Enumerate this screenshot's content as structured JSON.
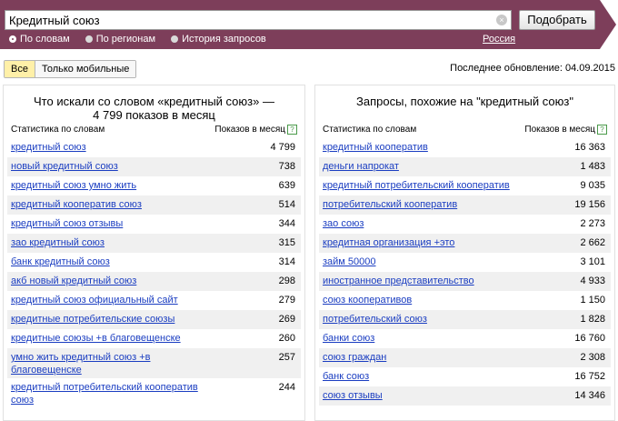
{
  "search": {
    "query": "Кредитный союз",
    "submit_label": "Подобрать",
    "clear_symbol": "×"
  },
  "radios": [
    {
      "label": "По словам",
      "checked": true
    },
    {
      "label": "По регионам",
      "checked": false
    },
    {
      "label": "История запросов",
      "checked": false
    }
  ],
  "region": "Россия",
  "filter": {
    "all_label": "Все",
    "mobile_label": "Только мобильные"
  },
  "update_info": "Последнее обновление: 04.09.2015",
  "left_panel": {
    "title": "Что искали со словом «кредитный союз» — 4 799 показов в месяц",
    "col_phrase": "Статистика по словам",
    "col_count": "Показов в месяц",
    "rows": [
      {
        "phrase": "кредитный союз",
        "count": "4 799"
      },
      {
        "phrase": "новый кредитный союз",
        "count": "738"
      },
      {
        "phrase": "кредитный союз умно жить",
        "count": "639"
      },
      {
        "phrase": "кредитный кооператив союз",
        "count": "514"
      },
      {
        "phrase": "кредитный союз отзывы",
        "count": "344"
      },
      {
        "phrase": "зао кредитный союз",
        "count": "315"
      },
      {
        "phrase": "банк кредитный союз",
        "count": "314"
      },
      {
        "phrase": "акб новый кредитный союз",
        "count": "298"
      },
      {
        "phrase": "кредитный союз официальный сайт",
        "count": "279"
      },
      {
        "phrase": "кредитные потребительские союзы",
        "count": "269"
      },
      {
        "phrase": "кредитные союзы +в благовещенске",
        "count": "260"
      },
      {
        "phrase": "умно жить кредитный союз +в благовещенске",
        "count": "257"
      },
      {
        "phrase": "кредитный потребительский кооператив союз",
        "count": "244"
      }
    ]
  },
  "right_panel": {
    "title": "Запросы, похожие на \"кредитный союз\"",
    "col_phrase": "Статистика по словам",
    "col_count": "Показов в месяц",
    "rows": [
      {
        "phrase": "кредитный кооператив",
        "count": "16 363"
      },
      {
        "phrase": "деньги напрокат",
        "count": "1 483"
      },
      {
        "phrase": "кредитный потребительский кооператив",
        "count": "9 035"
      },
      {
        "phrase": "потребительский кооператив",
        "count": "19 156"
      },
      {
        "phrase": "зао союз",
        "count": "2 273"
      },
      {
        "phrase": "кредитная организация +это",
        "count": "2 662"
      },
      {
        "phrase": "займ 50000",
        "count": "3 101"
      },
      {
        "phrase": "иностранное представительство",
        "count": "4 933"
      },
      {
        "phrase": "союз кооперативов",
        "count": "1 150"
      },
      {
        "phrase": "потребительский союз",
        "count": "1 828"
      },
      {
        "phrase": "банки союз",
        "count": "16 760"
      },
      {
        "phrase": "союз граждан",
        "count": "2 308"
      },
      {
        "phrase": "банк союз",
        "count": "16 752"
      },
      {
        "phrase": "союз отзывы",
        "count": "14 346"
      }
    ]
  },
  "help_symbol": "?",
  "colors": {
    "header": "#7d3e5a",
    "link": "#1a3dc1",
    "active_filter": "#fff0a8",
    "row_alt": "#f0f0f0"
  }
}
